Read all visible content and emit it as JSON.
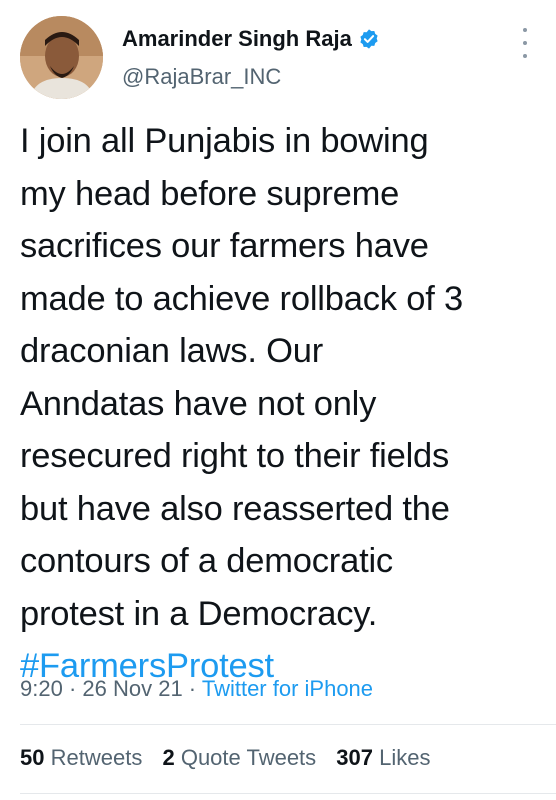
{
  "user": {
    "name": "Amarinder Singh Raja",
    "handle": "@RajaBrar_INC",
    "verified_icon": "verified-badge-icon",
    "more_icon": "more-vertical-icon"
  },
  "tweet": {
    "lines": [
      "I join all Punjabis in bowing",
      "my head before supreme",
      "sacrifices our farmers have",
      "made to achieve rollback of 3",
      "draconian laws. Our",
      "Anndatas have not only",
      "resecured right to their fields",
      "but have also reasserted the",
      "contours of a democratic",
      "protest in a Democracy."
    ],
    "hashtag": "#FarmersProtest"
  },
  "meta": {
    "time": "9:20",
    "separator": " · ",
    "date": "26 Nov 21",
    "source": "Twitter for iPhone"
  },
  "stats": {
    "retweets_count": "50",
    "retweets_label": "Retweets",
    "quotes_count": "2",
    "quotes_label": "Quote Tweets",
    "likes_count": "307",
    "likes_label": "Likes"
  },
  "colors": {
    "accent": "#1d9bf0",
    "text": "#0f1419",
    "secondary": "#536471"
  }
}
